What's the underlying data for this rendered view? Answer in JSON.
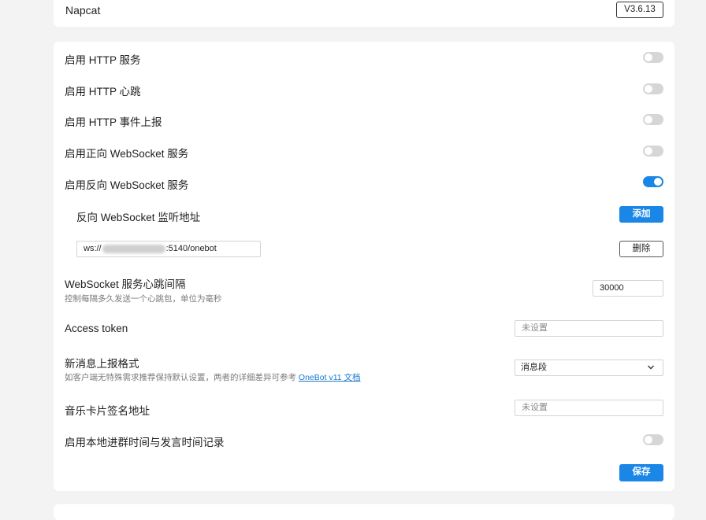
{
  "app": {
    "name": "Napcat",
    "version": "V3.6.13"
  },
  "settings": {
    "http_service": {
      "label": "启用 HTTP 服务",
      "enabled": false
    },
    "http_heartbeat": {
      "label": "启用 HTTP 心跳",
      "enabled": false
    },
    "http_event_report": {
      "label": "启用 HTTP 事件上报",
      "enabled": false
    },
    "forward_ws": {
      "label": "启用正向 WebSocket 服务",
      "enabled": false
    },
    "reverse_ws": {
      "label": "启用反向 WebSocket 服务",
      "enabled": true
    },
    "reverse_ws_addresses": {
      "label": "反向 WebSocket 监听地址",
      "add_label": "添加",
      "entry_prefix": "ws://",
      "entry_suffix": ":5140/onebot",
      "delete_label": "删除"
    },
    "ws_heartbeat": {
      "label": "WebSocket 服务心跳间隔",
      "description": "控制每隔多久发送一个心跳包，单位为毫秒",
      "value": "30000"
    },
    "access_token": {
      "label": "Access token",
      "placeholder": "未设置"
    },
    "message_format": {
      "label": "新消息上报格式",
      "description": "如客户端无特殊需求推荐保持默认设置，两者的详细差异可参考",
      "link_text": "OneBot v11 文档",
      "selected": "消息段"
    },
    "music_sign_url": {
      "label": "音乐卡片签名地址",
      "placeholder": "未设置"
    },
    "local_group_time": {
      "label": "启用本地进群时间与发言时间记录",
      "enabled": false
    },
    "save_label": "保存"
  },
  "colors": {
    "accent": "#1a87e6",
    "toggle_off": "#d6d6d6",
    "background": "#f3f3f3"
  },
  "icons": {
    "dropdown": "chevron-down-icon"
  }
}
